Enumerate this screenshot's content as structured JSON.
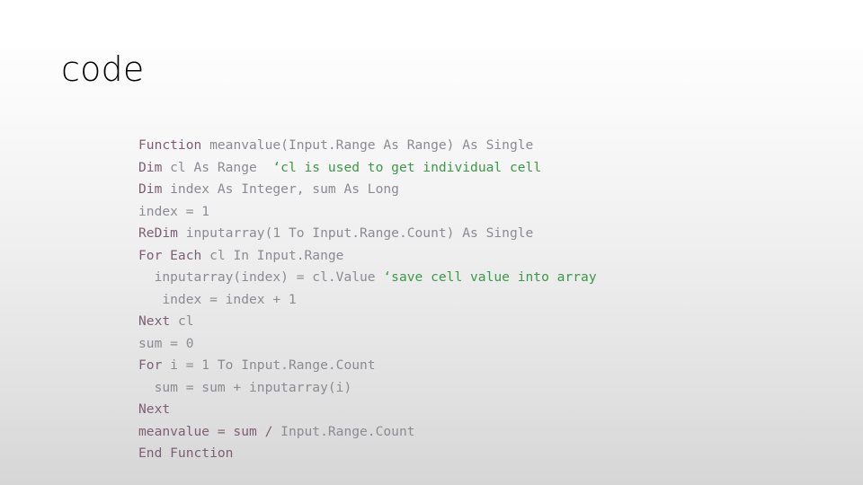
{
  "slide": {
    "title": "code",
    "background_top_color": "#ffffff",
    "background_bottom_color": "#d6d6d6"
  },
  "code": {
    "language": "VBA",
    "colors": {
      "keyword": "#7d5f74",
      "plain": "#8c8a92",
      "comment": "#3a9a45"
    },
    "lines": [
      {
        "text": "Function meanvalue(Input.Range As Range) As Single",
        "tokens": [
          {
            "t": "Function",
            "c": "kw"
          },
          {
            "t": " meanvalue(Input.Range As Range) As Single",
            "c": "plain"
          }
        ]
      },
      {
        "text": "Dim cl As Range  ‘cl is used to get individual cell",
        "tokens": [
          {
            "t": "Dim",
            "c": "kw"
          },
          {
            "t": " cl As Range  ",
            "c": "plain"
          },
          {
            "t": "‘cl is used to get individual cell",
            "c": "comment"
          }
        ]
      },
      {
        "text": "Dim index As Integer, sum As Long",
        "tokens": [
          {
            "t": "Dim",
            "c": "kw"
          },
          {
            "t": " index As Integer, sum As Long",
            "c": "plain"
          }
        ]
      },
      {
        "text": "index = 1",
        "tokens": [
          {
            "t": "index = 1",
            "c": "plain"
          }
        ]
      },
      {
        "text": "ReDim inputarray(1 To Input.Range.Count) As Single",
        "tokens": [
          {
            "t": "ReDim",
            "c": "kw"
          },
          {
            "t": " inputarray(1 To Input.Range.Count) As Single",
            "c": "plain"
          }
        ]
      },
      {
        "text": "For Each cl In Input.Range",
        "tokens": [
          {
            "t": "For Each",
            "c": "kw"
          },
          {
            "t": " cl In Input.Range",
            "c": "plain"
          }
        ]
      },
      {
        "text": "  inputarray(index) = cl.Value ‘save cell value into array",
        "tokens": [
          {
            "t": "  inputarray(index) = cl.Value ",
            "c": "plain"
          },
          {
            "t": "‘save cell value into array",
            "c": "comment"
          }
        ]
      },
      {
        "text": "   index = index + 1",
        "tokens": [
          {
            "t": "   index = index + 1",
            "c": "plain"
          }
        ]
      },
      {
        "text": "Next cl",
        "tokens": [
          {
            "t": "Next",
            "c": "kw"
          },
          {
            "t": " cl",
            "c": "plain"
          }
        ]
      },
      {
        "text": "sum = 0",
        "tokens": [
          {
            "t": "sum = 0",
            "c": "plain"
          }
        ]
      },
      {
        "text": "For i = 1 To Input.Range.Count",
        "tokens": [
          {
            "t": "For",
            "c": "kw"
          },
          {
            "t": " i = 1 To Input.Range.Count",
            "c": "plain"
          }
        ]
      },
      {
        "text": "  sum = sum + inputarray(i)",
        "tokens": [
          {
            "t": "  sum = sum + inputarray(i)",
            "c": "plain"
          }
        ]
      },
      {
        "text": "Next",
        "tokens": [
          {
            "t": "Next",
            "c": "kw"
          }
        ]
      },
      {
        "text": "meanvalue = sum / Input.Range.Count",
        "tokens": [
          {
            "t": "meanvalue = sum / ",
            "c": "kw"
          },
          {
            "t": "Input.Range.Count",
            "c": "plain"
          }
        ]
      },
      {
        "text": "End Function",
        "tokens": [
          {
            "t": "End Function",
            "c": "kw"
          }
        ]
      }
    ]
  }
}
